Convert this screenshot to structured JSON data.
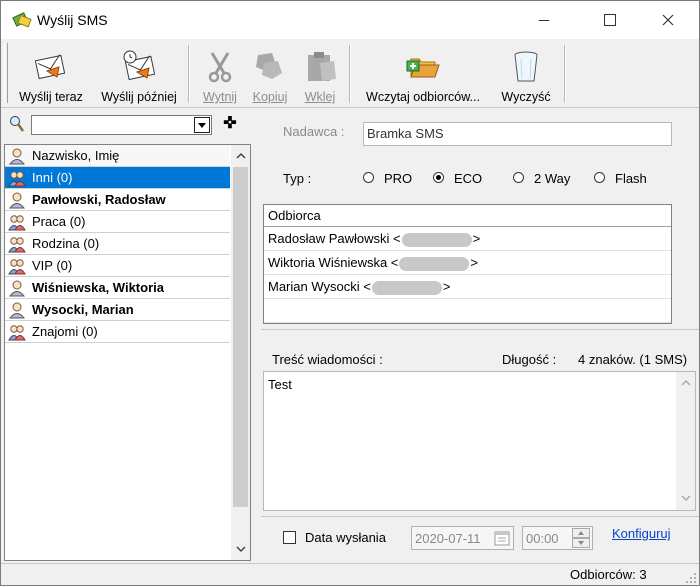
{
  "window": {
    "title": "Wyślij SMS",
    "controls": {
      "minimize": "—",
      "maximize": "☐",
      "close": "✕"
    }
  },
  "toolbar": {
    "send_now": "Wyślij teraz",
    "send_later": "Wyślij później",
    "cut": "Wytnij",
    "copy": "Kopiuj",
    "paste": "Wklej",
    "load_recipients": "Wczytaj odbiorców...",
    "clear": "Wyczyść"
  },
  "contacts": {
    "search_value": "",
    "header": "Nazwisko, Imię",
    "items": [
      {
        "label": "Inni (0)",
        "selected": true,
        "bold": false,
        "kind": "group"
      },
      {
        "label": "Pawłowski, Radosław",
        "selected": false,
        "bold": true,
        "kind": "person"
      },
      {
        "label": "Praca (0)",
        "selected": false,
        "bold": false,
        "kind": "group"
      },
      {
        "label": "Rodzina (0)",
        "selected": false,
        "bold": false,
        "kind": "group"
      },
      {
        "label": "VIP (0)",
        "selected": false,
        "bold": false,
        "kind": "group"
      },
      {
        "label": "Wiśniewska, Wiktoria",
        "selected": false,
        "bold": true,
        "kind": "person"
      },
      {
        "label": "Wysocki, Marian",
        "selected": false,
        "bold": true,
        "kind": "person"
      },
      {
        "label": "Znajomi (0)",
        "selected": false,
        "bold": false,
        "kind": "group"
      }
    ]
  },
  "sender": {
    "label": "Nadawca :",
    "value": "Bramka SMS"
  },
  "type": {
    "label": "Typ :",
    "options": [
      "PRO",
      "ECO",
      "2 Way",
      "Flash"
    ],
    "selected": "ECO"
  },
  "recipients": {
    "header": "Odbiorca",
    "rows": [
      {
        "name": "Radosław Pawłowski <",
        "suffix": ">"
      },
      {
        "name": "Wiktoria Wiśniewska <",
        "suffix": ">"
      },
      {
        "name": "Marian Wysocki <",
        "suffix": ">"
      }
    ]
  },
  "message": {
    "label": "Treść wiadomości :",
    "length_label": "Długość :",
    "length_value": "4 znaków. (1 SMS)",
    "text": "Test"
  },
  "schedule": {
    "checkbox_label": "Data wysłania",
    "date": "2020-07-11",
    "time": "00:00",
    "configure_link": "Konfiguruj"
  },
  "status": {
    "recipients_count": "Odbiorców: 3"
  },
  "colors": {
    "selection": "#0078d7",
    "link": "#0645c7"
  }
}
